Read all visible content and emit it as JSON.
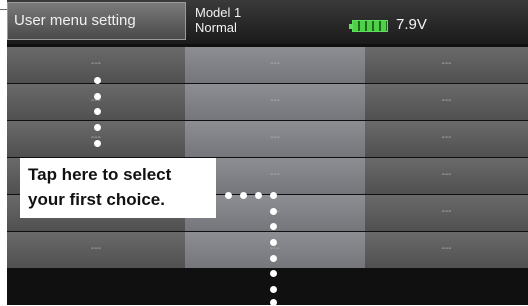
{
  "header": {
    "menu_title": "User menu setting",
    "model_name": "Model 1",
    "model_mode": "Normal",
    "battery_voltage": "7.9V"
  },
  "grid": {
    "rows": [
      [
        "---",
        "---",
        "---"
      ],
      [
        "---",
        "---",
        "---"
      ],
      [
        "---",
        "---",
        "---"
      ],
      [
        "---",
        "---",
        "---"
      ],
      [
        "---",
        "---",
        "---"
      ],
      [
        "---",
        "---",
        "---"
      ]
    ]
  },
  "callout": {
    "line1": "Tap here to select",
    "line2": "your first choice."
  },
  "icons": {
    "battery": "battery-icon"
  }
}
